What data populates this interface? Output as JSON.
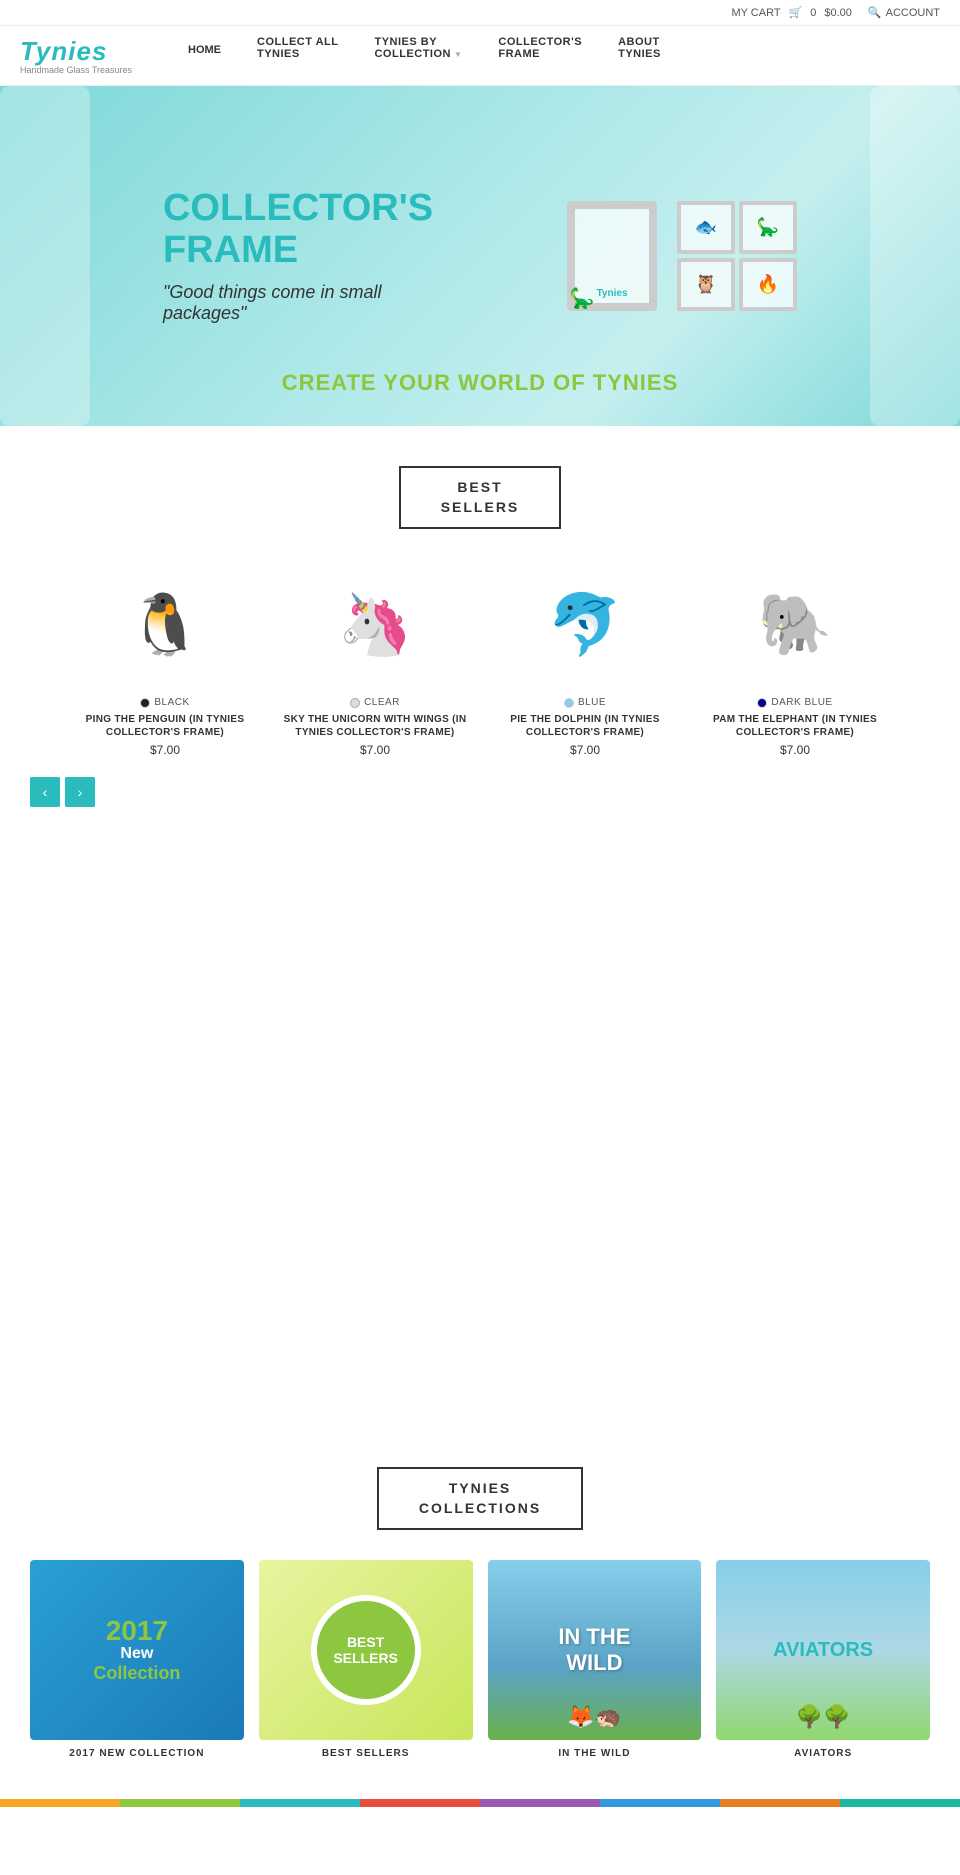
{
  "topbar": {
    "cart_label": "MY CART",
    "cart_icon": "shopping-cart",
    "cart_count": "0",
    "cart_amount": "$0.00",
    "account_label": "ACCOUNT",
    "search_icon": "search"
  },
  "header": {
    "logo_text": "Tynies",
    "logo_sub": "Handmade Glass Treasures",
    "nav_home": "HOME",
    "nav_collect_all_line1": "COLLECT ALL",
    "nav_collect_all_line2": "TYNIES",
    "nav_tynies_by_line1": "TYNIES BY",
    "nav_tynies_by_line2": "COLLECTION",
    "nav_collectors_line1": "COLLECTOR'S",
    "nav_collectors_line2": "FRAME",
    "nav_about_line1": "ABOUT",
    "nav_about_line2": "TYNIES"
  },
  "hero": {
    "title": "COLLECTOR'S\nFRAME",
    "quote": "\"Good things come in small packages\"",
    "subtitle": "CREATE YOUR WORLD OF TYNIES"
  },
  "best_sellers_section": {
    "title_line1": "BEST",
    "title_line2": "SELLERS"
  },
  "products": [
    {
      "name": "PING THE PENGUIN (IN TYNIES COLLECTOR'S FRAME)",
      "price": "$7.00",
      "color_label": "BLACK",
      "color_hex": "#222",
      "emoji": "🐧"
    },
    {
      "name": "SKY THE UNICORN WITH WINGS (IN TYNIES COLLECTOR'S FRAME)",
      "price": "$7.00",
      "color_label": "CLEAR",
      "color_hex": "#ddd",
      "emoji": "🦄"
    },
    {
      "name": "PIE THE DOLPHIN (IN TYNIES COLLECTOR'S FRAME)",
      "price": "$7.00",
      "color_label": "BLUE",
      "color_hex": "#87ceeb",
      "emoji": "🐬"
    },
    {
      "name": "PAM THE ELEPHANT (IN TYNIES COLLECTOR'S FRAME)",
      "price": "$7.00",
      "color_label": "DARK BLUE",
      "color_hex": "#00008b",
      "emoji": "🐘"
    }
  ],
  "carousel": {
    "prev_label": "‹",
    "next_label": "›"
  },
  "collections_section": {
    "title_line1": "TYNIES",
    "title_line2": "COLLECTIONS"
  },
  "collections": [
    {
      "label": "2017 NEW COLLECTION",
      "title_year": "2017",
      "title_new": "New",
      "title_collection": "Collection",
      "type": "2017"
    },
    {
      "label": "BEST SELLERS",
      "title": "BEST SELLERS",
      "type": "bestsellers"
    },
    {
      "label": "IN THE WILD",
      "title": "IN THE WILD",
      "type": "wild"
    },
    {
      "label": "AVIATORS",
      "title": "AVIATORS",
      "type": "aviators"
    }
  ],
  "bottom_stripes": [
    "#f5a623",
    "#8dc63f",
    "#2abcbc",
    "#e74c3c",
    "#9b59b6",
    "#3498db",
    "#e67e22",
    "#1abc9c"
  ]
}
